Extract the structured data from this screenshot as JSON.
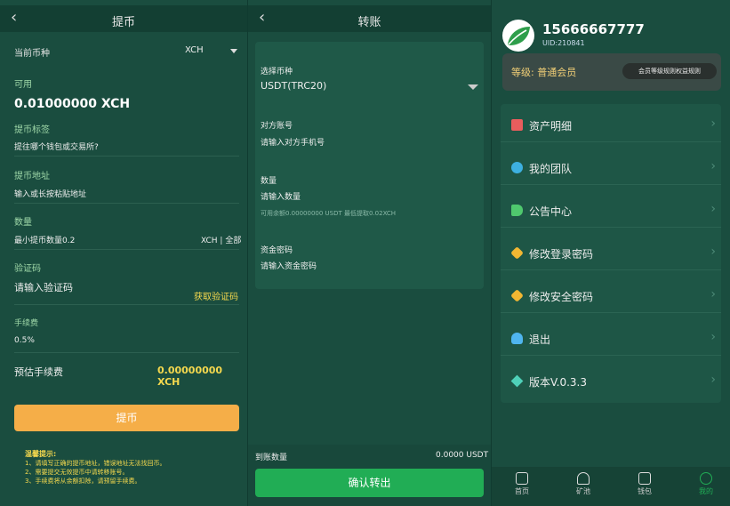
{
  "withdraw": {
    "title": "提币",
    "currency_label": "当前币种",
    "currency_value": "XCH",
    "available_label": "可用",
    "available_value": "0.01000000 XCH",
    "tag_label": "提币标签",
    "tag_placeholder": "提往哪个钱包或交易所?",
    "address_label": "提币地址",
    "address_placeholder": "输入或长按粘贴地址",
    "amount_label": "数量",
    "amount_placeholder": "最小提币数量0.2",
    "amount_unit": "XCH | 全部",
    "code_label": "验证码",
    "code_placeholder": "请输入验证码",
    "get_code": "获取验证码",
    "fee_label": "手续费",
    "fee_value": "0.5%",
    "est_fee_label": "预估手续费",
    "est_fee_value": "0.00000000 XCH",
    "submit": "提币",
    "tips_title": "温馨提示:",
    "tip1": "1、请填写正确的提币地址，错误地址无法找回币。",
    "tip2": "2、需要提交无效提币中请转移账号。",
    "tip3": "3、手续费将从余额扣除，请预留手续费。"
  },
  "transfer": {
    "title": "转账",
    "currency_label": "选择币种",
    "currency_value": "USDT(TRC20)",
    "account_label": "对方账号",
    "account_placeholder": "请输入对方手机号",
    "amount_label": "数量",
    "amount_placeholder": "请输入数量",
    "amount_hint": "可用余额0.00000000 USDT 最低提取0.02XCH",
    "password_label": "资金密码",
    "password_placeholder": "请输入资金密码",
    "received_label": "到账数量",
    "received_value": "0.0000 USDT",
    "confirm": "确认转出"
  },
  "profile": {
    "phone": "15666667777",
    "uid": "UID:210841",
    "level_label": "等级: 普通会员",
    "level_button": "会员等级规则权益规则",
    "menu": [
      {
        "label": "资产明细",
        "icon": "clipboard-icon",
        "color": "#e85d5d"
      },
      {
        "label": "我的团队",
        "icon": "team-icon",
        "color": "#3db0e0"
      },
      {
        "label": "公告中心",
        "icon": "megaphone-icon",
        "color": "#4fc86e"
      },
      {
        "label": "修改登录密码",
        "icon": "lock-icon",
        "color": "#f2b732"
      },
      {
        "label": "修改安全密码",
        "icon": "shield-icon",
        "color": "#f2b732"
      },
      {
        "label": "退出",
        "icon": "user-icon",
        "color": "#4fb5ef"
      },
      {
        "label": "版本V.0.3.3",
        "icon": "diamond-icon",
        "color": "#4fd0b8"
      }
    ],
    "nav": [
      {
        "label": "首页",
        "icon": "home-icon"
      },
      {
        "label": "矿池",
        "icon": "mining-icon"
      },
      {
        "label": "钱包",
        "icon": "wallet-icon"
      },
      {
        "label": "我的",
        "icon": "profile-icon"
      }
    ]
  },
  "colors": {
    "accent_orange": "#f5ae48",
    "accent_green": "#21ad55",
    "highlight_yellow": "#f4d84e"
  }
}
